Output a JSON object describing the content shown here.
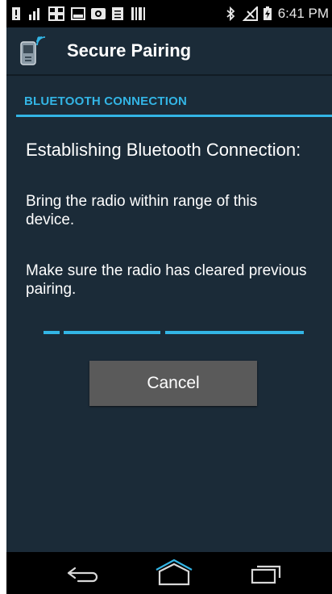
{
  "status_bar": {
    "time": "6:41 PM",
    "left_icons": [
      "notification-icon",
      "signal-icon",
      "apps-grid-icon",
      "image-icon",
      "camera-icon",
      "document-icon",
      "barcode-icon"
    ],
    "right_icons": [
      "bluetooth-icon",
      "no-signal-icon",
      "battery-charging-icon"
    ]
  },
  "action_bar": {
    "title": "Secure Pairing",
    "icon": "bluetooth-device-icon"
  },
  "section": {
    "header": "BLUETOOTH CONNECTION"
  },
  "content": {
    "heading": "Establishing Bluetooth Connection:",
    "instruction_1": "Bring the radio within range of this device.",
    "instruction_2": "Make sure the radio has cleared previous pairing."
  },
  "buttons": {
    "cancel_label": "Cancel"
  },
  "nav_bar": {
    "icons": [
      "back-icon",
      "home-icon",
      "recent-apps-icon"
    ]
  },
  "colors": {
    "accent": "#33b5e5",
    "background": "#1b2b38",
    "button": "#5a5a5a"
  }
}
